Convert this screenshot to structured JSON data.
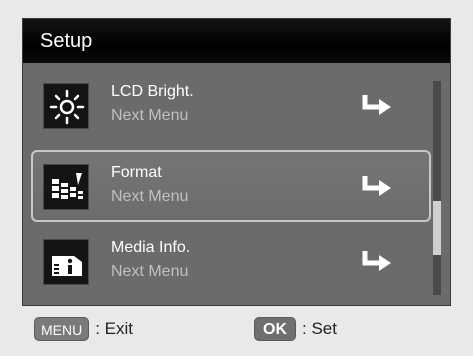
{
  "header": {
    "title": "Setup"
  },
  "menu": {
    "items": [
      {
        "label": "LCD Bright.",
        "sub": "Next Menu",
        "icon": "brightness-icon"
      },
      {
        "label": "Format",
        "sub": "Next Menu",
        "icon": "format-icon"
      },
      {
        "label": "Media Info.",
        "sub": "Next Menu",
        "icon": "media-info-icon"
      }
    ],
    "selected_index": 1
  },
  "footer": {
    "menu_key": "MENU",
    "exit_label": ": Exit",
    "ok_key": "OK",
    "set_label": ": Set"
  },
  "colors": {
    "screen_bg": "#6b6b6b",
    "titlebar_bg": "#000000",
    "selected_border": "#c8c8c8"
  }
}
